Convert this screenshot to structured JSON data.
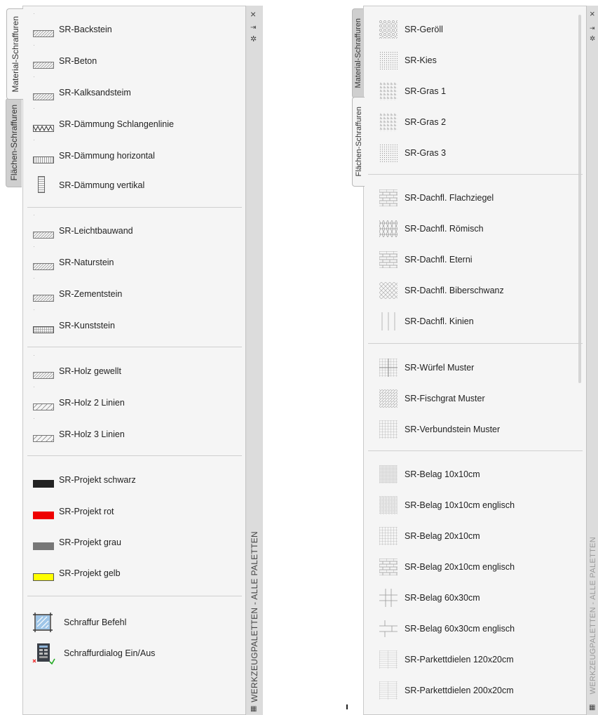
{
  "left_palette": {
    "tabs": [
      {
        "label": "Material-Schraffuren",
        "active": true
      },
      {
        "label": "Flächen-Schraffuren",
        "active": false
      }
    ],
    "strip_title": "WERKZEUGPALETTEN - ALLE PALETTEN",
    "controls": {
      "close": "×",
      "pin": "⇥",
      "settings": "✲"
    },
    "items": [
      {
        "label": "SR-Backstein",
        "icon": "hatch-diagonal"
      },
      {
        "label": "SR-Beton",
        "icon": "hatch-diagonal"
      },
      {
        "label": "SR-Kalksandsteim",
        "icon": "hatch-diagonal"
      },
      {
        "label": "SR-Dämmung Schlangenlinie",
        "icon": "hatch-zigzag"
      },
      {
        "label": "SR-Dämmung horizontal",
        "icon": "hatch-vertical-lines"
      },
      {
        "label": "SR-Dämmung vertikal",
        "icon": "hatch-tall"
      },
      {
        "label": "SR-Leichtbauwand",
        "icon": "hatch-diagonal"
      },
      {
        "label": "SR-Naturstein",
        "icon": "hatch-diagonal"
      },
      {
        "label": "SR-Zementstein",
        "icon": "hatch-diagonal"
      },
      {
        "label": "SR-Kunststein",
        "icon": "hatch-grid"
      },
      {
        "label": "SR-Holz gewellt",
        "icon": "hatch-diagonal"
      },
      {
        "label": "SR-Holz 2 Linien",
        "icon": "hatch-diagonal"
      },
      {
        "label": "SR-Holz 3 Linien",
        "icon": "hatch-diagonal"
      },
      {
        "label": "SR-Projekt schwarz",
        "icon": "swatch",
        "color": "#222222"
      },
      {
        "label": "SR-Projekt rot",
        "icon": "swatch",
        "color": "#ee0000"
      },
      {
        "label": "SR-Projekt grau",
        "icon": "swatch",
        "color": "#777777"
      },
      {
        "label": "SR-Projekt gelb",
        "icon": "swatch",
        "color": "#ffff00"
      },
      {
        "label": "Schraffur Befehl",
        "icon": "hatch-command"
      },
      {
        "label": "Schraffurdialog Ein/Aus",
        "icon": "hatch-dialog"
      }
    ]
  },
  "right_palette": {
    "tabs": [
      {
        "label": "Material-Schraffuren",
        "active": false
      },
      {
        "label": "Flächen-Schraffuren",
        "active": true
      }
    ],
    "strip_title": "WERKZEUGPALETTEN - ALLE PALETTEN",
    "items": [
      {
        "label": "SR-Geröll",
        "icon": "pattern-gravel"
      },
      {
        "label": "SR-Kies",
        "icon": "pattern-dots"
      },
      {
        "label": "SR-Gras 1",
        "icon": "pattern-grass"
      },
      {
        "label": "SR-Gras 2",
        "icon": "pattern-grass"
      },
      {
        "label": "SR-Gras 3",
        "icon": "pattern-dots"
      },
      {
        "label": "SR-Dachfl. Flachziegel",
        "icon": "pattern-bricks"
      },
      {
        "label": "SR-Dachfl. Römisch",
        "icon": "pattern-roman"
      },
      {
        "label": "SR-Dachfl. Eterni",
        "icon": "pattern-bricks"
      },
      {
        "label": "SR-Dachfl. Biberschwanz",
        "icon": "pattern-diamond"
      },
      {
        "label": "SR-Dachfl. Kinien",
        "icon": "pattern-vertical"
      },
      {
        "label": "SR-Würfel Muster",
        "icon": "pattern-cube"
      },
      {
        "label": "SR-Fischgrat Muster",
        "icon": "pattern-herringbone"
      },
      {
        "label": "SR-Verbundstein Muster",
        "icon": "pattern-grid"
      },
      {
        "label": "SR-Belag 10x10cm",
        "icon": "pattern-finegrid"
      },
      {
        "label": "SR-Belag 10x10cm englisch",
        "icon": "pattern-fineoffset"
      },
      {
        "label": "SR-Belag 20x10cm",
        "icon": "pattern-grid"
      },
      {
        "label": "SR-Belag 20x10cm englisch",
        "icon": "pattern-bricks"
      },
      {
        "label": "SR-Belag 60x30cm",
        "icon": "pattern-cross"
      },
      {
        "label": "SR-Belag 60x30cm englisch",
        "icon": "pattern-bricks"
      },
      {
        "label": "SR-Parkettdielen 120x20cm",
        "icon": "pattern-planks"
      },
      {
        "label": "SR-Parkettdielen 200x20cm",
        "icon": "pattern-planks"
      }
    ]
  }
}
